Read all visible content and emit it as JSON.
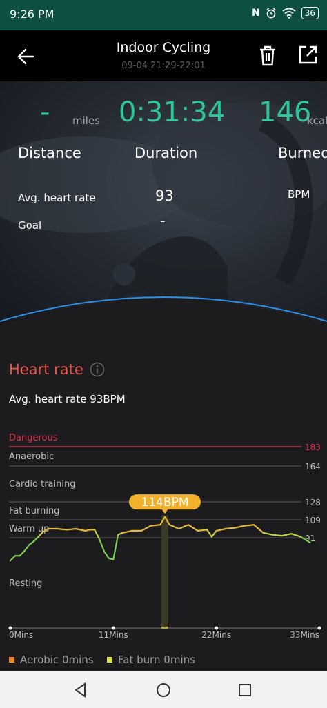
{
  "status_bar": {
    "time": "9:26 PM",
    "nfc": "N",
    "battery": "36"
  },
  "header": {
    "title": "Indoor Cycling",
    "subtitle": "09-04 21:29-22:01"
  },
  "summary": {
    "distance": {
      "value": "-",
      "unit": "miles",
      "label": "Distance"
    },
    "duration": {
      "value": "0:31:34",
      "label": "Duration"
    },
    "burned": {
      "value": "146",
      "unit": "kcal",
      "label": "Burned"
    },
    "avg_heart_rate": {
      "label": "Avg. heart rate",
      "value": "93",
      "unit": "BPM"
    },
    "goal": {
      "label": "Goal",
      "value": "-"
    }
  },
  "heart_rate": {
    "title": "Heart rate",
    "avg_text": "Avg. heart rate 93BPM",
    "zones": [
      {
        "label": "Dangerous",
        "threshold": "183",
        "color": "#e0334c"
      },
      {
        "label": "Anaerobic",
        "threshold": "164"
      },
      {
        "label": "Cardio training",
        "threshold": "128"
      },
      {
        "label": "Fat burning",
        "threshold": "109"
      },
      {
        "label": "Warm up",
        "threshold": "91"
      },
      {
        "label": "Resting"
      }
    ],
    "tooltip": "114BPM",
    "legend": [
      {
        "label": "Aerobic 0mins",
        "color": "#f08a1c"
      },
      {
        "label": "Fat burn 0mins",
        "color": "#d8e34a"
      }
    ]
  },
  "chart_data": {
    "type": "line",
    "x_ticks": [
      "0Mins",
      "11Mins",
      "22Mins",
      "33Mins"
    ],
    "xlim": [
      0,
      33
    ],
    "ylim": [
      55,
      183
    ],
    "highlight": {
      "x": 16.5,
      "y": 114
    },
    "series": [
      {
        "x": [
          0,
          0.5,
          1,
          1.5,
          2,
          2.5,
          3,
          3.5,
          4,
          5,
          6,
          7,
          8,
          8.5,
          9,
          9.5,
          10,
          10.5,
          11,
          11.5,
          12,
          13,
          14,
          15,
          16,
          16.5,
          17,
          18,
          19,
          20,
          21,
          21.5,
          22,
          23,
          24,
          25,
          26,
          27,
          28,
          29,
          30,
          31,
          32
        ],
        "y": [
          72,
          76,
          76,
          80,
          85,
          88,
          92,
          97,
          100,
          100,
          99,
          100,
          98,
          99,
          99,
          90,
          80,
          74,
          73,
          94,
          96,
          98,
          98,
          103,
          104,
          112,
          104,
          100,
          104,
          98,
          99,
          92,
          98,
          100,
          101,
          103,
          104,
          96,
          94,
          93,
          95,
          92,
          87
        ]
      }
    ]
  }
}
